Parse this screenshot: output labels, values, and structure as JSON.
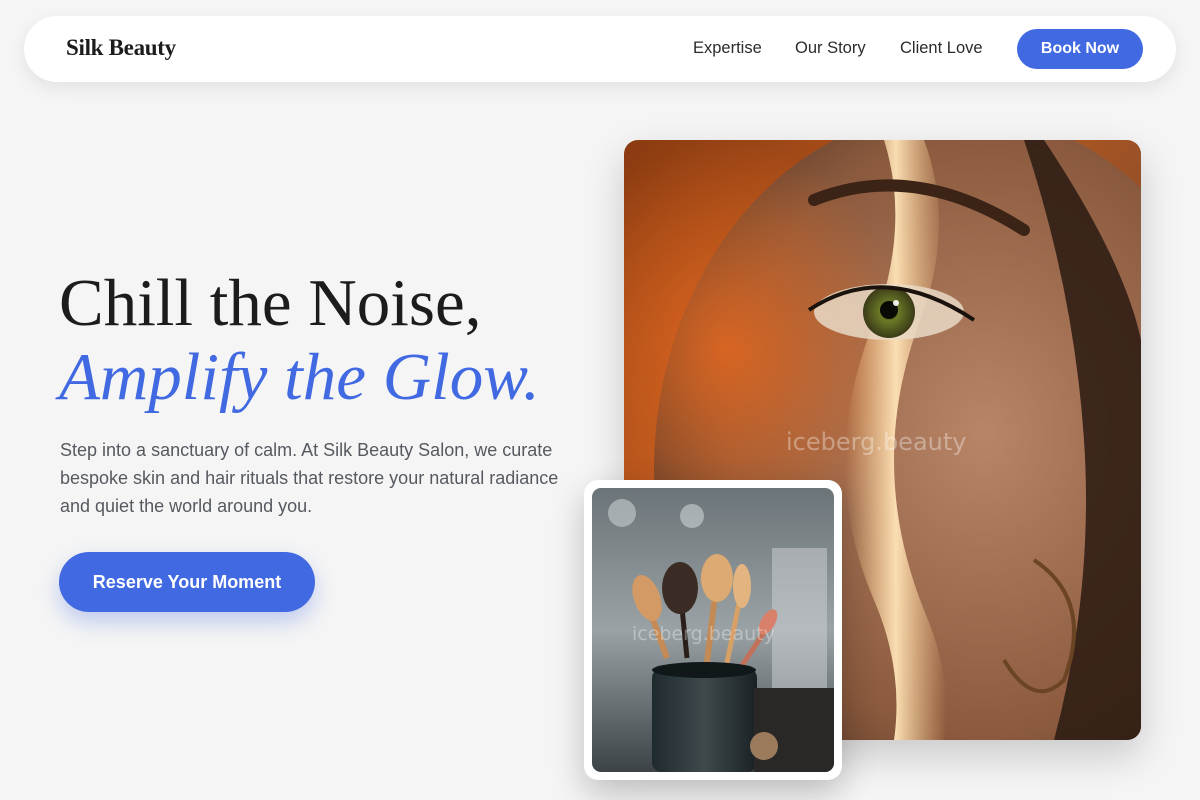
{
  "brand": {
    "name": "Silk Beauty"
  },
  "nav": {
    "links": [
      "Expertise",
      "Our Story",
      "Client Love"
    ],
    "book_label": "Book Now"
  },
  "hero": {
    "title_line1": "Chill the Noise,",
    "title_line2": "Amplify the Glow.",
    "description": "Step into a sanctuary of calm. At Silk Beauty Salon, we curate bespoke skin and hair rituals that restore your natural radiance and quiet the world around you.",
    "cta_label": "Reserve Your Moment"
  },
  "images": {
    "main": {
      "subject": "close-up of woman's face with streak of light",
      "watermark": "iceberg.beauty"
    },
    "secondary": {
      "subject": "makeup brushes in holder",
      "watermark": "iceberg.beauty"
    }
  },
  "colors": {
    "accent": "#4169e1",
    "background": "#f5f5f5",
    "text_dark": "#1c1c1c",
    "text_muted": "#555a60"
  }
}
